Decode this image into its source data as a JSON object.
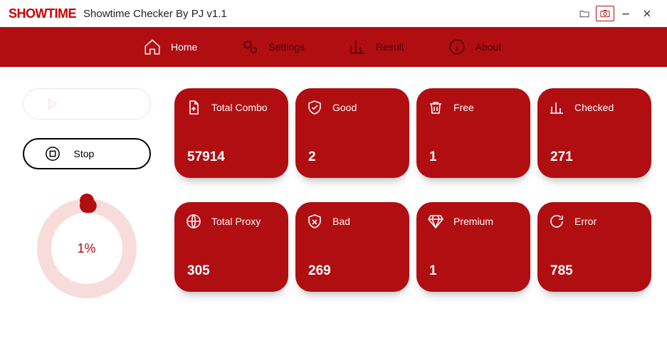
{
  "title_bar": {
    "logo_text": "SHOWTIME",
    "app_title": "Showtime Checker By PJ v1.1"
  },
  "nav": {
    "home": "Home",
    "settings": "Settings",
    "result": "Result",
    "about": "About"
  },
  "controls": {
    "start_label": "",
    "stop_label": "Stop"
  },
  "progress": {
    "percent_label": "1%",
    "percent_value": 1
  },
  "stats": {
    "total_combo": {
      "label": "Total Combo",
      "value": "57914"
    },
    "good": {
      "label": "Good",
      "value": "2"
    },
    "free": {
      "label": "Free",
      "value": "1"
    },
    "checked": {
      "label": "Checked",
      "value": "271"
    },
    "total_proxy": {
      "label": "Total Proxy",
      "value": "305"
    },
    "bad": {
      "label": "Bad",
      "value": "269"
    },
    "premium": {
      "label": "Premium",
      "value": "1"
    },
    "error": {
      "label": "Error",
      "value": "785"
    }
  },
  "colors": {
    "brand_red": "#b10e12",
    "progress_track": "#f8dcdc"
  }
}
